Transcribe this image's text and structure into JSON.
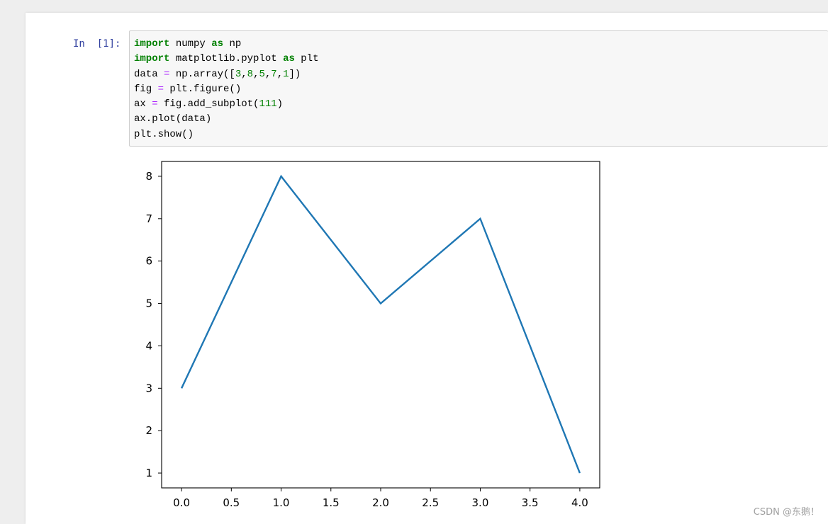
{
  "cell": {
    "prompt": "In  [1]:",
    "lines": [
      [
        {
          "t": "import",
          "k": "kw"
        },
        {
          "t": " numpy ",
          "k": "p"
        },
        {
          "t": "as",
          "k": "kw"
        },
        {
          "t": " np",
          "k": "p"
        }
      ],
      [
        {
          "t": "import",
          "k": "kw"
        },
        {
          "t": " matplotlib.pyplot ",
          "k": "p"
        },
        {
          "t": "as",
          "k": "kw"
        },
        {
          "t": " plt",
          "k": "p"
        }
      ],
      [
        {
          "t": "data ",
          "k": "p"
        },
        {
          "t": "=",
          "k": "op"
        },
        {
          "t": " np.array([",
          "k": "p"
        },
        {
          "t": "3",
          "k": "num"
        },
        {
          "t": ",",
          "k": "p"
        },
        {
          "t": "8",
          "k": "num"
        },
        {
          "t": ",",
          "k": "p"
        },
        {
          "t": "5",
          "k": "num"
        },
        {
          "t": ",",
          "k": "p"
        },
        {
          "t": "7",
          "k": "num"
        },
        {
          "t": ",",
          "k": "p"
        },
        {
          "t": "1",
          "k": "num"
        },
        {
          "t": "])",
          "k": "p"
        }
      ],
      [
        {
          "t": "fig ",
          "k": "p"
        },
        {
          "t": "=",
          "k": "op"
        },
        {
          "t": " plt.figure()",
          "k": "p"
        }
      ],
      [
        {
          "t": "ax ",
          "k": "p"
        },
        {
          "t": "=",
          "k": "op"
        },
        {
          "t": " fig.add_subplot(",
          "k": "p"
        },
        {
          "t": "111",
          "k": "num"
        },
        {
          "t": ")",
          "k": "p"
        }
      ],
      [
        {
          "t": "ax.plot(data)",
          "k": "p"
        }
      ],
      [
        {
          "t": "plt.show()",
          "k": "p"
        }
      ]
    ]
  },
  "chart_data": {
    "type": "line",
    "x": [
      0,
      1,
      2,
      3,
      4
    ],
    "series": [
      {
        "values": [
          3,
          8,
          5,
          7,
          1
        ],
        "color": "#1f77b4"
      }
    ],
    "xlim": [
      -0.2,
      4.2
    ],
    "ylim": [
      0.65,
      8.35
    ],
    "xticks": [
      "0.0",
      "0.5",
      "1.0",
      "1.5",
      "2.0",
      "2.5",
      "3.0",
      "3.5",
      "4.0"
    ],
    "xtick_values": [
      0,
      0.5,
      1,
      1.5,
      2,
      2.5,
      3,
      3.5,
      4
    ],
    "yticks": [
      "1",
      "2",
      "3",
      "4",
      "5",
      "6",
      "7",
      "8"
    ],
    "ytick_values": [
      1,
      2,
      3,
      4,
      5,
      6,
      7,
      8
    ],
    "title": "",
    "xlabel": "",
    "ylabel": "",
    "grid": false
  },
  "watermark": "CSDN @东鹅！"
}
